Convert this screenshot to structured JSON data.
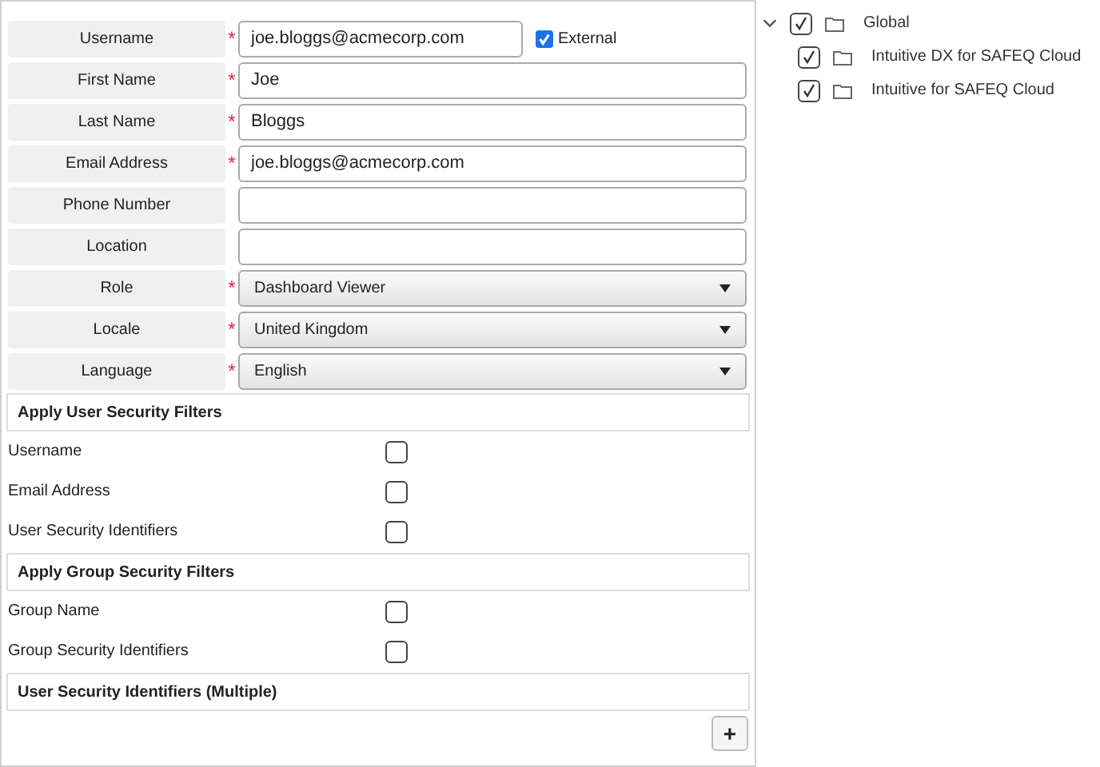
{
  "fields": [
    {
      "label": "Username",
      "kind": "text",
      "required": true,
      "value": "joe.bloggs@acmecorp.com",
      "extra": {
        "label": "External",
        "checked": true
      }
    },
    {
      "label": "First Name",
      "kind": "text",
      "required": true,
      "value": "Joe"
    },
    {
      "label": "Last Name",
      "kind": "text",
      "required": true,
      "value": "Bloggs"
    },
    {
      "label": "Email Address",
      "kind": "text",
      "required": true,
      "value": "joe.bloggs@acmecorp.com"
    },
    {
      "label": "Phone Number",
      "kind": "text",
      "required": false
    },
    {
      "label": "Location",
      "kind": "text",
      "required": false
    },
    {
      "label": "Role",
      "kind": "select",
      "required": true,
      "value": "Dashboard Viewer"
    },
    {
      "label": "Locale",
      "kind": "select",
      "required": true,
      "value": "United Kingdom"
    },
    {
      "label": "Language",
      "kind": "select",
      "required": true,
      "value": "English"
    }
  ],
  "required_mark": "*",
  "sections": [
    {
      "title": "Apply User Security Filters",
      "items": [
        {
          "label": "Username",
          "checked": false
        },
        {
          "label": "Email Address",
          "checked": false
        },
        {
          "label": "User Security Identifiers",
          "checked": false
        }
      ]
    },
    {
      "title": "Apply Group Security Filters",
      "items": [
        {
          "label": "Group Name",
          "checked": false
        },
        {
          "label": "Group Security Identifiers",
          "checked": false
        }
      ]
    },
    {
      "title": "User Security Identifiers (Multiple)",
      "add_button": "+"
    }
  ],
  "tree": [
    {
      "label": "Global",
      "checked": true,
      "expanded": true,
      "children": [
        {
          "label": "Intuitive DX for SAFEQ Cloud",
          "checked": true
        },
        {
          "label": "Intuitive for SAFEQ Cloud",
          "checked": true
        }
      ]
    }
  ]
}
